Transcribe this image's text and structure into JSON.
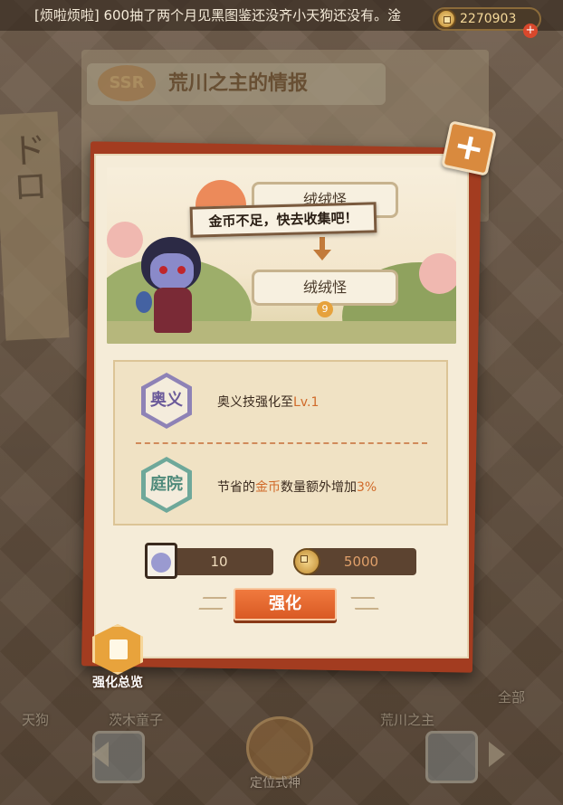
{
  "chat": {
    "message": "[烦啦烦啦] 600抽了两个月见黑图鉴还没齐小天狗还没有。淦",
    "coins": "2270903"
  },
  "background": {
    "ssr": "SSR",
    "book_title": "荒川之主的情报"
  },
  "dialog": {
    "close_label": "+",
    "evolve_from": "绒绒怪",
    "evolve_to": "绒绒怪",
    "evolve_badge": "9",
    "tooltip": "金币不足，快去收集吧！",
    "skills": [
      {
        "badge": "奥义",
        "text_prefix": "奥义技强化至",
        "text_highlight": "Lv.1",
        "text_suffix": ""
      },
      {
        "badge": "庭院",
        "text_prefix": "节省的",
        "text_highlight": "金币",
        "text_middle": "数量额外增加",
        "text_suffix": "3%"
      }
    ],
    "cost_fragments": "10",
    "cost_coins": "5000",
    "upgrade_label": "强化"
  },
  "overview_label": "强化总览",
  "bottom_tabs": [
    "天狗",
    "茨木童子",
    "荒川之主",
    "全部"
  ],
  "locate_label": "定位式神",
  "colors": {
    "card_red": "#a33c20",
    "upgrade_orange": "#e8672e",
    "highlight_orange": "#d06a2a",
    "hex_purple": "#8e82b6",
    "hex_green": "#6ea89a"
  }
}
